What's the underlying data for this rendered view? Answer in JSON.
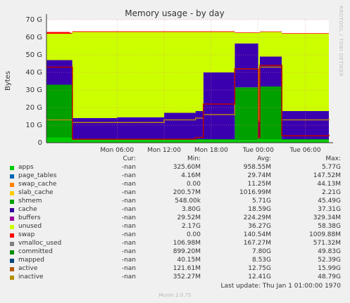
{
  "chart_data": {
    "type": "area",
    "title": "Memory usage - by day",
    "ylabel": "Bytes",
    "ylim": [
      0,
      70
    ],
    "y_unit": "G",
    "yticks": [
      "0",
      "10 G",
      "20 G",
      "30 G",
      "40 G",
      "50 G",
      "60 G",
      "70 G"
    ],
    "xticks": [
      "Mon 06:00",
      "Mon 12:00",
      "Mon 18:00",
      "Tue 00:00",
      "Tue 06:00"
    ],
    "x_hours": [
      -3,
      6,
      12,
      18,
      24,
      30,
      33
    ],
    "grid": true,
    "series": [
      {
        "name": "apps",
        "color": "#00cc00",
        "values": [
          3,
          3,
          1.5,
          1.5,
          1.5,
          1.5,
          1.5,
          1.5,
          2,
          2,
          1.5,
          1.5
        ]
      },
      {
        "name": "shmem",
        "color": "#00a000",
        "values": [
          30,
          30,
          0.5,
          0.5,
          0.5,
          0.5,
          0.5,
          30,
          0.5,
          30,
          0.5,
          0.5
        ]
      },
      {
        "name": "cache",
        "color": "#3a00b0",
        "values": [
          14,
          14,
          12,
          12.5,
          15,
          16,
          38,
          25,
          10,
          17,
          16,
          16.5
        ]
      },
      {
        "name": "unused",
        "color": "#ccff00",
        "values": [
          15,
          15,
          49,
          48.5,
          46,
          45,
          23,
          6,
          50,
          14,
          44,
          44
        ]
      },
      {
        "name": "swap",
        "color": "#ff0000",
        "values": [
          1,
          0.5,
          0.4,
          0.4,
          0.4,
          0.4,
          0.4,
          0.3,
          0.3,
          0.3,
          0.3,
          0.3
        ]
      }
    ],
    "x_series_hours": [
      -3,
      0,
      0.3,
      6,
      12,
      16,
      17,
      21,
      24,
      24.2,
      27,
      33
    ],
    "lines": [
      {
        "name": "active",
        "color": "#b78414",
        "values": [
          13,
          13,
          11.5,
          11.5,
          13,
          14,
          16,
          42,
          12,
          43,
          13,
          13.5
        ]
      },
      {
        "name": "inactive",
        "color": "#b90000",
        "values": [
          43,
          43,
          2,
          2,
          2,
          3,
          22,
          42,
          3,
          44,
          4,
          4.5
        ]
      }
    ],
    "legend_headers": {
      "cur": "Cur:",
      "min": "Min:",
      "avg": "Avg:",
      "max": "Max:"
    },
    "legend": [
      {
        "name": "apps",
        "color": "#00cc00",
        "cur": "-nan",
        "min": "325.60M",
        "avg": "958.55M",
        "max": "5.77G"
      },
      {
        "name": "page_tables",
        "color": "#0066b3",
        "cur": "-nan",
        "min": "4.16M",
        "avg": "29.74M",
        "max": "147.52M"
      },
      {
        "name": "swap_cache",
        "color": "#ff8000",
        "cur": "-nan",
        "min": "0.00",
        "avg": "11.25M",
        "max": "44.13M"
      },
      {
        "name": "slab_cache",
        "color": "#ffcc00",
        "cur": "-nan",
        "min": "200.57M",
        "avg": "1016.99M",
        "max": "2.21G"
      },
      {
        "name": "shmem",
        "color": "#00a000",
        "cur": "-nan",
        "min": "548.00k",
        "avg": "5.71G",
        "max": "45.49G"
      },
      {
        "name": "cache",
        "color": "#330099",
        "cur": "-nan",
        "min": "3.80G",
        "avg": "18.59G",
        "max": "37.31G"
      },
      {
        "name": "buffers",
        "color": "#990099",
        "cur": "-nan",
        "min": "29.52M",
        "avg": "224.29M",
        "max": "329.34M"
      },
      {
        "name": "unused",
        "color": "#ccff00",
        "cur": "-nan",
        "min": "2.17G",
        "avg": "36.27G",
        "max": "58.38G"
      },
      {
        "name": "swap",
        "color": "#ff0000",
        "cur": "-nan",
        "min": "0.00",
        "avg": "140.54M",
        "max": "1009.88M"
      },
      {
        "name": "vmalloc_used",
        "color": "#808080",
        "cur": "-nan",
        "min": "106.98M",
        "avg": "167.27M",
        "max": "571.32M"
      },
      {
        "name": "committed",
        "color": "#008f00",
        "cur": "-nan",
        "min": "899.20M",
        "avg": "7.80G",
        "max": "49.83G"
      },
      {
        "name": "mapped",
        "color": "#00487d",
        "cur": "-nan",
        "min": "40.15M",
        "avg": "8.53G",
        "max": "52.39G"
      },
      {
        "name": "active",
        "color": "#b35a00",
        "cur": "-nan",
        "min": "121.61M",
        "avg": "12.75G",
        "max": "15.99G"
      },
      {
        "name": "inactive",
        "color": "#b38f00",
        "cur": "-nan",
        "min": "352.27M",
        "avg": "12.41G",
        "max": "48.79G"
      }
    ]
  },
  "footer": {
    "last_update": "Last update: Thu Jan  1 01:00:00 1970",
    "munin": "Munin 2.0.75",
    "side_label": "RRDTOOL / TOBI OETIKER"
  }
}
